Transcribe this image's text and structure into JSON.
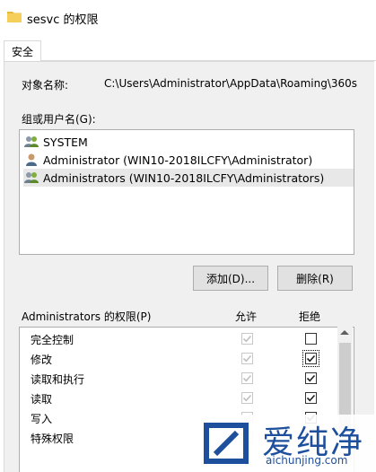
{
  "window": {
    "title": "sesvc 的权限"
  },
  "tabs": [
    {
      "label": "安全"
    }
  ],
  "object": {
    "label": "对象名称:",
    "value": "C:\\Users\\Administrator\\AppData\\Roaming\\360s"
  },
  "group": {
    "label": "组或用户名(G):",
    "principals": [
      {
        "name": "SYSTEM",
        "icon": "group-users-icon"
      },
      {
        "name": "Administrator (WIN10-2018ILCFY\\Administrator)",
        "icon": "user-icon"
      },
      {
        "name": "Administrators (WIN10-2018ILCFY\\Administrators)",
        "icon": "group-users-icon",
        "selected": true
      }
    ]
  },
  "buttons": {
    "add": "添加(D)...",
    "remove": "删除(R)"
  },
  "permissions": {
    "title": "Administrators 的权限(P)",
    "allow_header": "允许",
    "deny_header": "拒绝",
    "rows": [
      {
        "name": "完全控制",
        "allow": true,
        "allow_disabled": true,
        "deny": false
      },
      {
        "name": "修改",
        "allow": true,
        "allow_disabled": true,
        "deny": true,
        "deny_focused": true
      },
      {
        "name": "读取和执行",
        "allow": true,
        "allow_disabled": true,
        "deny": true
      },
      {
        "name": "读取",
        "allow": true,
        "allow_disabled": true,
        "deny": true
      },
      {
        "name": "写入",
        "allow": true,
        "allow_disabled": true,
        "deny": true
      },
      {
        "name": "特殊权限",
        "allow": false,
        "allow_disabled": true,
        "deny": false
      }
    ]
  },
  "watermark": {
    "text": "爱纯净",
    "url": "aichunjing.com",
    "faint": "爱纯净"
  },
  "colors": {
    "brand": "#1e4f9c",
    "folder": "#e8b938"
  }
}
